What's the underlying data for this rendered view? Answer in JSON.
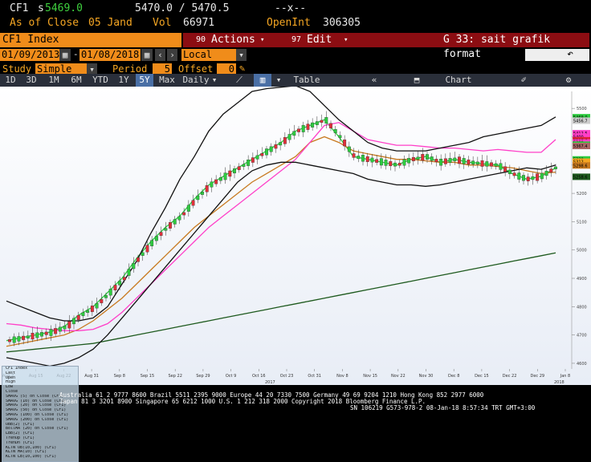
{
  "quote": {
    "ticker": "CF1",
    "last_prefix": "s",
    "last": "5469.0",
    "bid_ask": "5470.0 / 5470.5",
    "change": "--x--",
    "as_of_label": "As of Close",
    "as_of_date": "05 Jand",
    "vol_label": "Vol",
    "vol": "66971",
    "openint_label": "OpenInt",
    "openint": "306305"
  },
  "toolbar": {
    "security": "CF1 Index",
    "actions_num": "90",
    "actions_label": "Actions",
    "edit_num": "97",
    "edit_label": "Edit",
    "page_title": "G 33: sait grafik format"
  },
  "dates": {
    "start": "01/09/2013",
    "end": "01/08/2018",
    "currency": "Local CCY"
  },
  "study": {
    "study_label": "Study",
    "study_value": "Simple MA",
    "period_label": "Period",
    "period_value": "5",
    "offset_label": "Offset",
    "offset_value": "0"
  },
  "ranges": [
    "1D",
    "3D",
    "1M",
    "6M",
    "YTD",
    "1Y",
    "5Y",
    "Max"
  ],
  "selected_range": "5Y",
  "frequency": "Daily",
  "table_label": "Table",
  "chart_content_label": "Chart Content",
  "chart_data": {
    "type": "line",
    "x_ticks": [
      "Aug 7",
      "Aug 15",
      "Aug 22",
      "Aug 31",
      "Sep 8",
      "Sep 15",
      "Sep 22",
      "Sep 29",
      "Oct 9",
      "Oct 16",
      "Oct 23",
      "Oct 31",
      "Nov 8",
      "Nov 15",
      "Nov 22",
      "Nov 30",
      "Dec 8",
      "Dec 15",
      "Dec 22",
      "Dec 29",
      "Jan 8"
    ],
    "x_years": [
      "2017",
      "2018"
    ],
    "y_ticks": [
      5500,
      5400,
      5300,
      5200,
      5100,
      5000,
      4900,
      4800,
      4700,
      4600
    ],
    "ylim": [
      4580,
      5560
    ],
    "series": [
      {
        "color": "#2ecc40",
        "values": [
          4680,
          4690,
          4700,
          4710,
          4730,
          4770,
          4800,
          4850,
          4900,
          4970,
          5030,
          5080,
          5120,
          5180,
          5230,
          5260,
          5290,
          5320,
          5350,
          5380,
          5420,
          5440,
          5460,
          5400,
          5330,
          5320,
          5310,
          5300,
          5320,
          5330,
          5310,
          5320,
          5310,
          5305,
          5300,
          5270,
          5250,
          5260,
          5290
        ]
      },
      {
        "color": "#c87a20",
        "values": [
          4660,
          4670,
          4680,
          4690,
          4700,
          4720,
          4750,
          4790,
          4830,
          4880,
          4930,
          4980,
          5030,
          5080,
          5120,
          5160,
          5200,
          5240,
          5270,
          5300,
          5330,
          5380,
          5400,
          5380,
          5350,
          5340,
          5330,
          5320,
          5320,
          5315,
          5310,
          5310,
          5300,
          5300,
          5295,
          5290,
          5280,
          5270,
          5275
        ]
      },
      {
        "color": "#ff3fc8",
        "values": [
          4740,
          4735,
          4725,
          4720,
          4715,
          4715,
          4720,
          4740,
          4780,
          4830,
          4880,
          4930,
          4980,
          5030,
          5080,
          5120,
          5160,
          5200,
          5240,
          5280,
          5320,
          5380,
          5440,
          5450,
          5420,
          5390,
          5380,
          5370,
          5370,
          5365,
          5360,
          5360,
          5355,
          5350,
          5355,
          5350,
          5345,
          5345,
          5390
        ]
      },
      {
        "color": "#1e5a1e",
        "values": [
          4640,
          4645,
          4650,
          4655,
          4660,
          4665,
          4670,
          4680,
          4690,
          4700,
          4710,
          4720,
          4730,
          4740,
          4750,
          4760,
          4770,
          4780,
          4790,
          4800,
          4810,
          4820,
          4830,
          4840,
          4850,
          4860,
          4870,
          4880,
          4890,
          4900,
          4910,
          4920,
          4930,
          4940,
          4950,
          4960,
          4970,
          4980,
          4990
        ]
      },
      {
        "color": "#111111",
        "values": [
          4820,
          4800,
          4780,
          4760,
          4750,
          4750,
          4760,
          4800,
          4880,
          4960,
          5060,
          5150,
          5250,
          5330,
          5420,
          5480,
          5520,
          5560,
          5570,
          5575,
          5580,
          5560,
          5510,
          5460,
          5420,
          5380,
          5360,
          5350,
          5350,
          5350,
          5360,
          5370,
          5380,
          5400,
          5410,
          5420,
          5430,
          5440,
          5470
        ]
      },
      {
        "color": "#111111",
        "values": [
          4620,
          4610,
          4600,
          4590,
          4600,
          4620,
          4650,
          4700,
          4760,
          4820,
          4880,
          4940,
          5000,
          5060,
          5120,
          5180,
          5240,
          5280,
          5300,
          5310,
          5310,
          5300,
          5290,
          5280,
          5270,
          5250,
          5240,
          5230,
          5230,
          5225,
          5230,
          5240,
          5250,
          5260,
          5270,
          5280,
          5290,
          5285,
          5300
        ]
      }
    ]
  },
  "legend_rows": [
    "CF1 Index",
    "Last",
    "Open",
    "High",
    "Low",
    "Close",
    "SMAVG (5) on Close (CF1)",
    "SMAVG (10) on Close (CF1)",
    "SMAVG (20) on Close (CF1)",
    "SMAVG (50) on Close (CF1)",
    "SMAVG (100) on Close (CF1)",
    "SMAVG (200) on Close (CF1)",
    "UBB(2) (CF1)",
    "BollMA (20) on Close (CF1)",
    "LBB(2) (CF1)",
    "TrenUp (CF1)",
    "TrenDn (CF1)",
    "KLTN UB(10,100) (CF1)",
    "KLTN MA(10) (CF1)",
    "KLTN LB(10,100) (CF1)"
  ],
  "right_labels": [
    "5469.0",
    "5456.7",
    "5412.5",
    "5400",
    "5387.6",
    "5380",
    "5372",
    "5367.4",
    "5320",
    "5312",
    "5298.6",
    "5258.6"
  ],
  "footer": {
    "line1": "Australia 61 2 9777 8600 Brazil 5511 2395 9000 Europe 44 20 7330 7500 Germany 49 69 9204 1210 Hong Kong 852 2977 6000",
    "line2": "Japan 81 3 3201 8900       Singapore 65 6212 1000       U.S. 1 212 318 2000              Copyright 2018 Bloomberg Finance L.P.",
    "line3": "SN 106219 G573-978-2 08-Jan-18  8:57:34 TRT  GMT+3:00"
  }
}
